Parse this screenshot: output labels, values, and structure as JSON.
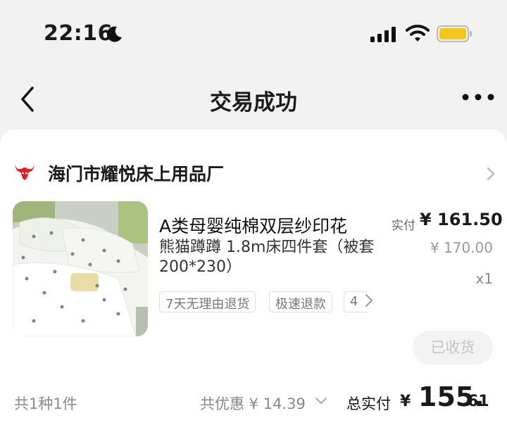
{
  "status_bar": {
    "time": "22:16",
    "moon_icon": "moon-icon",
    "signal_icon": "cellular-signal-icon",
    "wifi_icon": "wifi-icon",
    "battery_icon": "battery-icon",
    "battery_color": "#f5c518"
  },
  "nav": {
    "back_icon": "chevron-left-icon",
    "title": "交易成功",
    "more_icon": "more-dots-icon"
  },
  "shop": {
    "logo_icon": "bull-logo-icon",
    "name": "海门市耀悦床上用品厂",
    "arrow_icon": "chevron-right-icon"
  },
  "product": {
    "image": "bedding-set-photo",
    "name_line1": "A类母婴纯棉双层纱印花",
    "name_line2": "熊猫蹲蹲 1.8m床四件套（被套200*230）",
    "paid_label": "实付",
    "paid_price": "¥ 161.50",
    "original_price": "¥ 170.00",
    "quantity": "x1",
    "tags": [
      "7天无理由退货",
      "极速退款",
      "4"
    ],
    "tags_more_icon": "chevron-right-icon",
    "status_button": "已收货"
  },
  "summary": {
    "count": "共1种1件",
    "discount": "共优惠 ¥ 14.39",
    "discount_chevron_icon": "chevron-down-icon",
    "total_label": "总实付",
    "total_yen": "¥",
    "total_int": "155.",
    "total_dec": "61"
  }
}
